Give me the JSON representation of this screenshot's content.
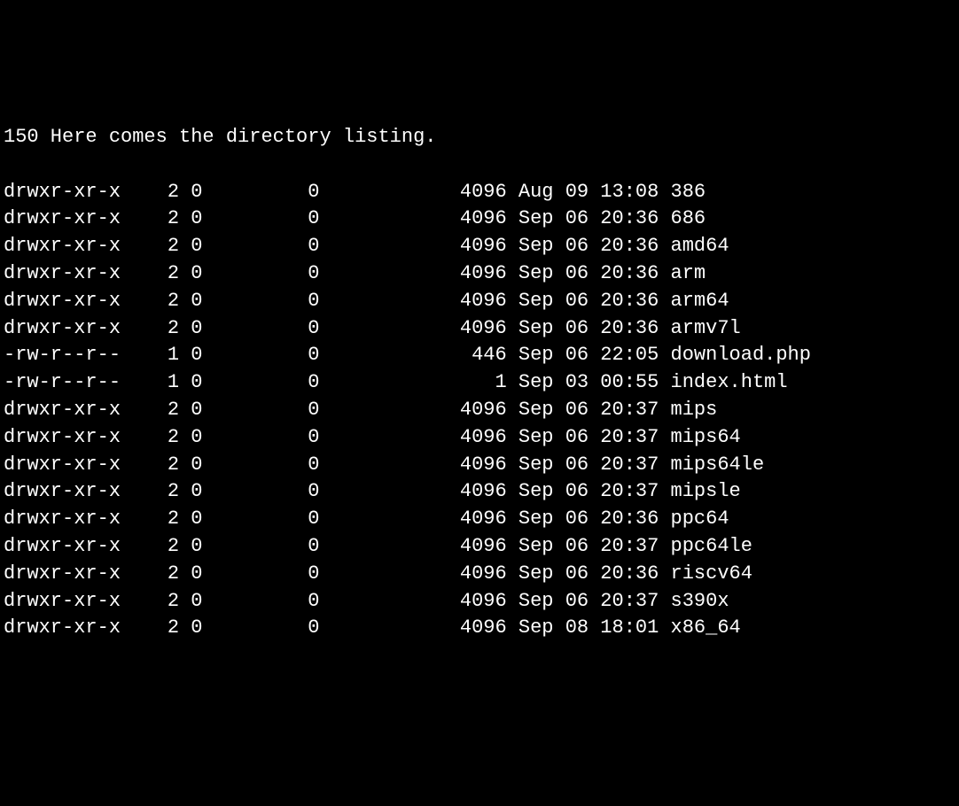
{
  "header": "150 Here comes the directory listing.",
  "listing": [
    {
      "perms": "drwxr-xr-x",
      "links": "2",
      "owner": "0",
      "group": "0",
      "size": "4096",
      "month": "Aug",
      "day": "09",
      "time": "13:08",
      "name": "386"
    },
    {
      "perms": "drwxr-xr-x",
      "links": "2",
      "owner": "0",
      "group": "0",
      "size": "4096",
      "month": "Sep",
      "day": "06",
      "time": "20:36",
      "name": "686"
    },
    {
      "perms": "drwxr-xr-x",
      "links": "2",
      "owner": "0",
      "group": "0",
      "size": "4096",
      "month": "Sep",
      "day": "06",
      "time": "20:36",
      "name": "amd64"
    },
    {
      "perms": "drwxr-xr-x",
      "links": "2",
      "owner": "0",
      "group": "0",
      "size": "4096",
      "month": "Sep",
      "day": "06",
      "time": "20:36",
      "name": "arm"
    },
    {
      "perms": "drwxr-xr-x",
      "links": "2",
      "owner": "0",
      "group": "0",
      "size": "4096",
      "month": "Sep",
      "day": "06",
      "time": "20:36",
      "name": "arm64"
    },
    {
      "perms": "drwxr-xr-x",
      "links": "2",
      "owner": "0",
      "group": "0",
      "size": "4096",
      "month": "Sep",
      "day": "06",
      "time": "20:36",
      "name": "armv7l"
    },
    {
      "perms": "-rw-r--r--",
      "links": "1",
      "owner": "0",
      "group": "0",
      "size": "446",
      "month": "Sep",
      "day": "06",
      "time": "22:05",
      "name": "download.php"
    },
    {
      "perms": "-rw-r--r--",
      "links": "1",
      "owner": "0",
      "group": "0",
      "size": "1",
      "month": "Sep",
      "day": "03",
      "time": "00:55",
      "name": "index.html"
    },
    {
      "perms": "drwxr-xr-x",
      "links": "2",
      "owner": "0",
      "group": "0",
      "size": "4096",
      "month": "Sep",
      "day": "06",
      "time": "20:37",
      "name": "mips"
    },
    {
      "perms": "drwxr-xr-x",
      "links": "2",
      "owner": "0",
      "group": "0",
      "size": "4096",
      "month": "Sep",
      "day": "06",
      "time": "20:37",
      "name": "mips64"
    },
    {
      "perms": "drwxr-xr-x",
      "links": "2",
      "owner": "0",
      "group": "0",
      "size": "4096",
      "month": "Sep",
      "day": "06",
      "time": "20:37",
      "name": "mips64le"
    },
    {
      "perms": "drwxr-xr-x",
      "links": "2",
      "owner": "0",
      "group": "0",
      "size": "4096",
      "month": "Sep",
      "day": "06",
      "time": "20:37",
      "name": "mipsle"
    },
    {
      "perms": "drwxr-xr-x",
      "links": "2",
      "owner": "0",
      "group": "0",
      "size": "4096",
      "month": "Sep",
      "day": "06",
      "time": "20:36",
      "name": "ppc64"
    },
    {
      "perms": "drwxr-xr-x",
      "links": "2",
      "owner": "0",
      "group": "0",
      "size": "4096",
      "month": "Sep",
      "day": "06",
      "time": "20:37",
      "name": "ppc64le"
    },
    {
      "perms": "drwxr-xr-x",
      "links": "2",
      "owner": "0",
      "group": "0",
      "size": "4096",
      "month": "Sep",
      "day": "06",
      "time": "20:36",
      "name": "riscv64"
    },
    {
      "perms": "drwxr-xr-x",
      "links": "2",
      "owner": "0",
      "group": "0",
      "size": "4096",
      "month": "Sep",
      "day": "06",
      "time": "20:37",
      "name": "s390x"
    },
    {
      "perms": "drwxr-xr-x",
      "links": "2",
      "owner": "0",
      "group": "0",
      "size": "4096",
      "month": "Sep",
      "day": "08",
      "time": "18:01",
      "name": "x86_64"
    }
  ]
}
